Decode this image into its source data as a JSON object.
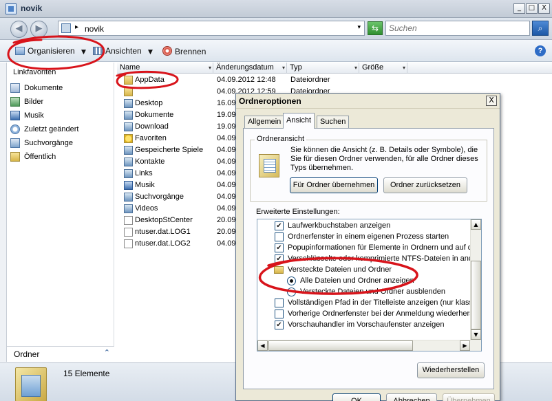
{
  "window": {
    "title": "novik",
    "controls": {
      "minimize": "_",
      "maximize": "□",
      "close": "X"
    }
  },
  "nav": {
    "back_glyph": "◀",
    "forward_glyph": "▶",
    "address_path": "novik",
    "address_sep": "▸",
    "address_dropdown": "▾",
    "refresh_glyph": "⇆",
    "search_placeholder": "Suchen",
    "search_glyph": "⌕"
  },
  "toolbar": {
    "organize": "Organisieren",
    "organize_arrow": "▼",
    "views": "Ansichten",
    "views_arrow": "▼",
    "burn": "Brennen",
    "help": "?"
  },
  "left_nav": {
    "heading": "Linkfavoriten",
    "items": [
      {
        "label": "Dokumente",
        "icon": "documents-icon"
      },
      {
        "label": "Bilder",
        "icon": "pictures-icon"
      },
      {
        "label": "Musik",
        "icon": "music-icon"
      },
      {
        "label": "Zuletzt geändert",
        "icon": "recent-icon"
      },
      {
        "label": "Suchvorgänge",
        "icon": "searches-icon"
      },
      {
        "label": "Öffentlich",
        "icon": "folder-icon"
      }
    ],
    "folder_pane": "Ordner",
    "folder_pane_chevron": "⌃"
  },
  "columns": [
    "Name",
    "Änderungsdatum",
    "Typ",
    "Größe"
  ],
  "column_arrow": "▾",
  "files": [
    {
      "name": "AppData",
      "date": "04.09.2012 12:48",
      "type": "Dateiordner",
      "icon": "folder"
    },
    {
      "name": "",
      "date": "04.09.2012 12:59",
      "type": "Dateiordner",
      "icon": "folder"
    },
    {
      "name": "Desktop",
      "date": "16.09",
      "type": "",
      "icon": "special"
    },
    {
      "name": "Dokumente",
      "date": "19.09",
      "type": "",
      "icon": "special"
    },
    {
      "name": "Download",
      "date": "19.09",
      "type": "",
      "icon": "special"
    },
    {
      "name": "Favoriten",
      "date": "04.09",
      "type": "",
      "icon": "favorites"
    },
    {
      "name": "Gespeicherte Spiele",
      "date": "04.09",
      "type": "",
      "icon": "special"
    },
    {
      "name": "Kontakte",
      "date": "04.09",
      "type": "",
      "icon": "special"
    },
    {
      "name": "Links",
      "date": "04.09",
      "type": "",
      "icon": "special"
    },
    {
      "name": "Musik",
      "date": "04.09",
      "type": "",
      "icon": "music"
    },
    {
      "name": "Suchvorgänge",
      "date": "04.09",
      "type": "",
      "icon": "special"
    },
    {
      "name": "Videos",
      "date": "04.09",
      "type": "",
      "icon": "special"
    },
    {
      "name": "DesktopStCenter",
      "date": "20.09",
      "type": "",
      "icon": "file"
    },
    {
      "name": "ntuser.dat.LOG1",
      "date": "20.09",
      "type": "",
      "icon": "file"
    },
    {
      "name": "ntuser.dat.LOG2",
      "date": "04.09",
      "type": "",
      "icon": "file"
    }
  ],
  "status": {
    "count": "15 Elemente"
  },
  "dialog": {
    "title": "Ordneroptionen",
    "close": "X",
    "tabs": [
      "Allgemein",
      "Ansicht",
      "Suchen"
    ],
    "active_tab": "Ansicht",
    "group_title": "Ordneransicht",
    "group_text": "Sie können die Ansicht (z. B. Details oder Symbole), die Sie für diesen Ordner verwenden, für alle Ordner dieses Typs übernehmen.",
    "apply_button": "Für Ordner übernehmen",
    "reset_button": "Ordner zurücksetzen",
    "advanced_label": "Erweiterte Einstellungen:",
    "options": [
      {
        "kind": "checkbox",
        "checked": true,
        "text": "Laufwerkbuchstaben anzeigen"
      },
      {
        "kind": "checkbox",
        "checked": false,
        "text": "Ordnerfenster in einem eigenen Prozess starten"
      },
      {
        "kind": "checkbox",
        "checked": true,
        "text": "Popupinformationen für Elemente in Ordnern und auf den"
      },
      {
        "kind": "checkbox",
        "checked": true,
        "text": "Verschlüsselte oder komprimierte NTFS-Dateien in ander"
      },
      {
        "kind": "folder",
        "checked": false,
        "text": "Versteckte Dateien und Ordner"
      },
      {
        "kind": "radio",
        "checked": true,
        "text": "Alle Dateien und Ordner anzeigen"
      },
      {
        "kind": "radio",
        "checked": false,
        "text": "Versteckte Dateien und Ordner ausblenden"
      },
      {
        "kind": "checkbox",
        "checked": false,
        "text": "Vollständigen Pfad in der Titelleiste anzeigen (nur klassis"
      },
      {
        "kind": "checkbox",
        "checked": false,
        "text": "Vorherige Ordnerfenster bei der Anmeldung wiederherste"
      },
      {
        "kind": "checkbox",
        "checked": true,
        "text": "Vorschauhandler im Vorschaufenster anzeigen"
      }
    ],
    "check_glyph": "✔",
    "scroll_up": "▲",
    "scroll_down": "▼",
    "scroll_left": "◀",
    "scroll_right": "▶",
    "restore_button": "Wiederherstellen",
    "ok_button": "OK",
    "cancel_button": "Abbrechen",
    "apply_disabled_button": "Übernehmen"
  },
  "colors": {
    "annotation_red": "#d8141b",
    "dialog_bg": "#ece9d8",
    "folder_yellow": "#e7c95f",
    "accent_blue": "#2e6cc6"
  }
}
